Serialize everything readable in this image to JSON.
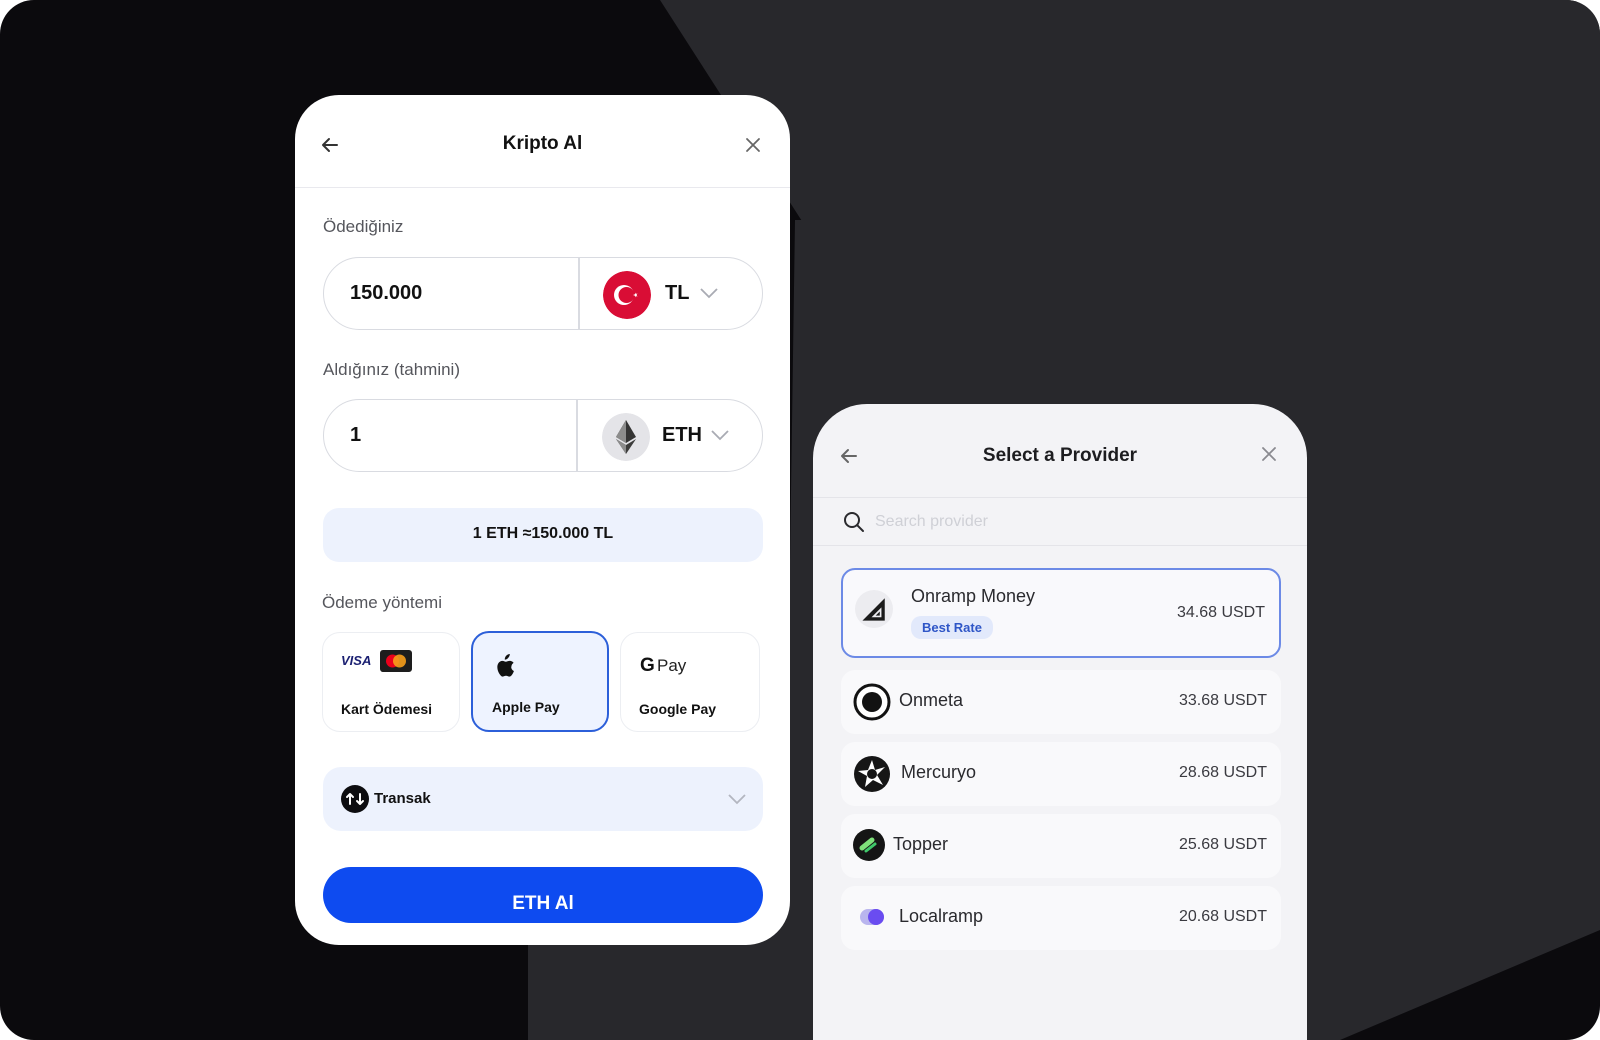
{
  "buy_card": {
    "title": "Kripto Al",
    "pay_label": "Ödediğiniz",
    "pay_amount": "150.000",
    "pay_currency": "TL",
    "receive_label": "Aldığınız (tahmini)",
    "receive_amount": "1",
    "receive_currency": "ETH",
    "rate_text": "1 ETH ≈150.000 TL",
    "method_label": "Ödeme yöntemi",
    "methods": [
      {
        "label": "Kart Ödemesi",
        "selected": false
      },
      {
        "label": "Apple Pay",
        "selected": true
      },
      {
        "label": "Google Pay",
        "selected": false
      }
    ],
    "provider": "Transak",
    "cta_label": "ETH Al"
  },
  "provider_card": {
    "title": "Select a Provider",
    "search_placeholder": "Search provider",
    "providers": [
      {
        "name": "Onramp Money",
        "price": "34.68 USDT",
        "badge": "Best Rate",
        "selected": true
      },
      {
        "name": "Onmeta",
        "price": "33.68 USDT",
        "selected": false
      },
      {
        "name": "Mercuryo",
        "price": "28.68 USDT",
        "selected": false
      },
      {
        "name": "Topper",
        "price": "25.68 USDT",
        "selected": false
      },
      {
        "name": "Localramp",
        "price": "20.68 USDT",
        "selected": false
      }
    ]
  },
  "icons": {
    "back": "arrow-left-icon",
    "close": "close-icon",
    "chevron": "chevron-down-icon",
    "search": "search-icon",
    "turkey_flag": "turkey-flag-icon",
    "eth": "ethereum-icon"
  },
  "colors": {
    "accent": "#0e4bf0",
    "selected_border": "#2c5fd9",
    "badge_bg": "#e2e9fb",
    "badge_text": "#2f56c7",
    "flag_red": "#d90d35"
  }
}
